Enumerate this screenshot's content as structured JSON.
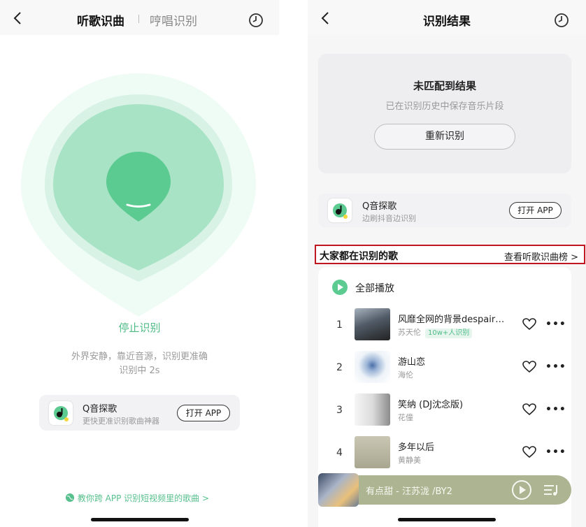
{
  "left": {
    "tabs": {
      "active": "听歌识曲",
      "inactive": "哼唱识别"
    },
    "stop_label": "停止识别",
    "hint_line1": "外界安静，靠近音源，识别更准确",
    "hint_line2": "识别中 2s",
    "promo": {
      "title": "Q音探歌",
      "subtitle": "更快更准识别歌曲神器",
      "button": "打开 APP"
    },
    "footer_link": "教你跨 APP 识别短视频里的歌曲 >"
  },
  "right": {
    "title": "识别结果",
    "no_match": {
      "title": "未匹配到结果",
      "subtitle": "已在识别历史中保存音乐片段",
      "retry": "重新识别"
    },
    "promo": {
      "title": "Q音探歌",
      "subtitle": "边刷抖音边识别",
      "button": "打开 APP"
    },
    "section": {
      "title": "大家都在识别的歌",
      "link": "查看听歌识曲榜 >"
    },
    "play_all": "全部播放",
    "songs": [
      {
        "rank": "1",
        "title": "风靡全网的背景despair…",
        "artist": "苏天伦",
        "badge": "10w+人识别"
      },
      {
        "rank": "2",
        "title": "游山恋",
        "artist": "海伦",
        "badge": ""
      },
      {
        "rank": "3",
        "title": "笑纳 (DJ沈念版)",
        "artist": "花僮",
        "badge": ""
      },
      {
        "rank": "4",
        "title": "多年以后",
        "artist": "黄静美",
        "badge": ""
      }
    ],
    "player": {
      "now_playing": "有点甜 - 汪苏泷 /BY2"
    }
  },
  "colors": {
    "accent_green": "#4dbb85",
    "highlight_red": "#c0161f",
    "player_bg": "#acb491"
  }
}
